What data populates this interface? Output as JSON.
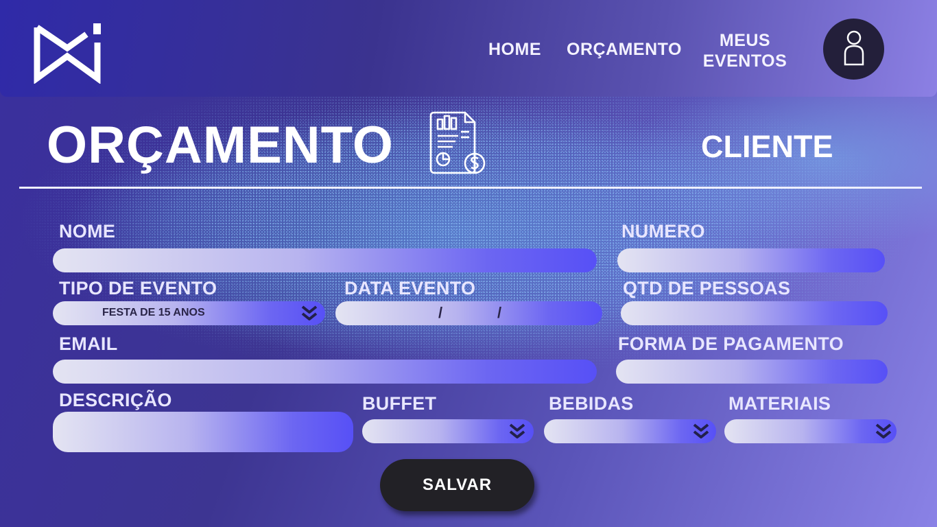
{
  "nav": {
    "home": "HOME",
    "orcamento": "ORÇAMENTO",
    "meus_eventos_line1": "MEUS",
    "meus_eventos_line2": "EVENTOS"
  },
  "page": {
    "title": "ORÇAMENTO",
    "role": "CLIENTE"
  },
  "form": {
    "nome_label": "NOME",
    "numero_label": "NUMERO",
    "tipo_evento_label": "TIPO DE EVENTO",
    "tipo_evento_value": "FESTA DE 15 ANOS",
    "data_evento_label": "DATA EVENTO",
    "date_sep": "/",
    "qtd_pessoas_label": "QTD DE PESSOAS",
    "email_label": "EMAIL",
    "forma_pagamento_label": "FORMA DE PAGAMENTO",
    "descricao_label": "DESCRIÇÃO",
    "buffet_label": "BUFFET",
    "bebidas_label": "BEBIDAS",
    "materiais_label": "MATERIAIS"
  },
  "actions": {
    "save": "SALVAR"
  },
  "icons": {
    "logo": "brand-logo",
    "user": "user-icon",
    "document": "budget-document-icon",
    "chevron": "double-chevron-down-icon"
  }
}
